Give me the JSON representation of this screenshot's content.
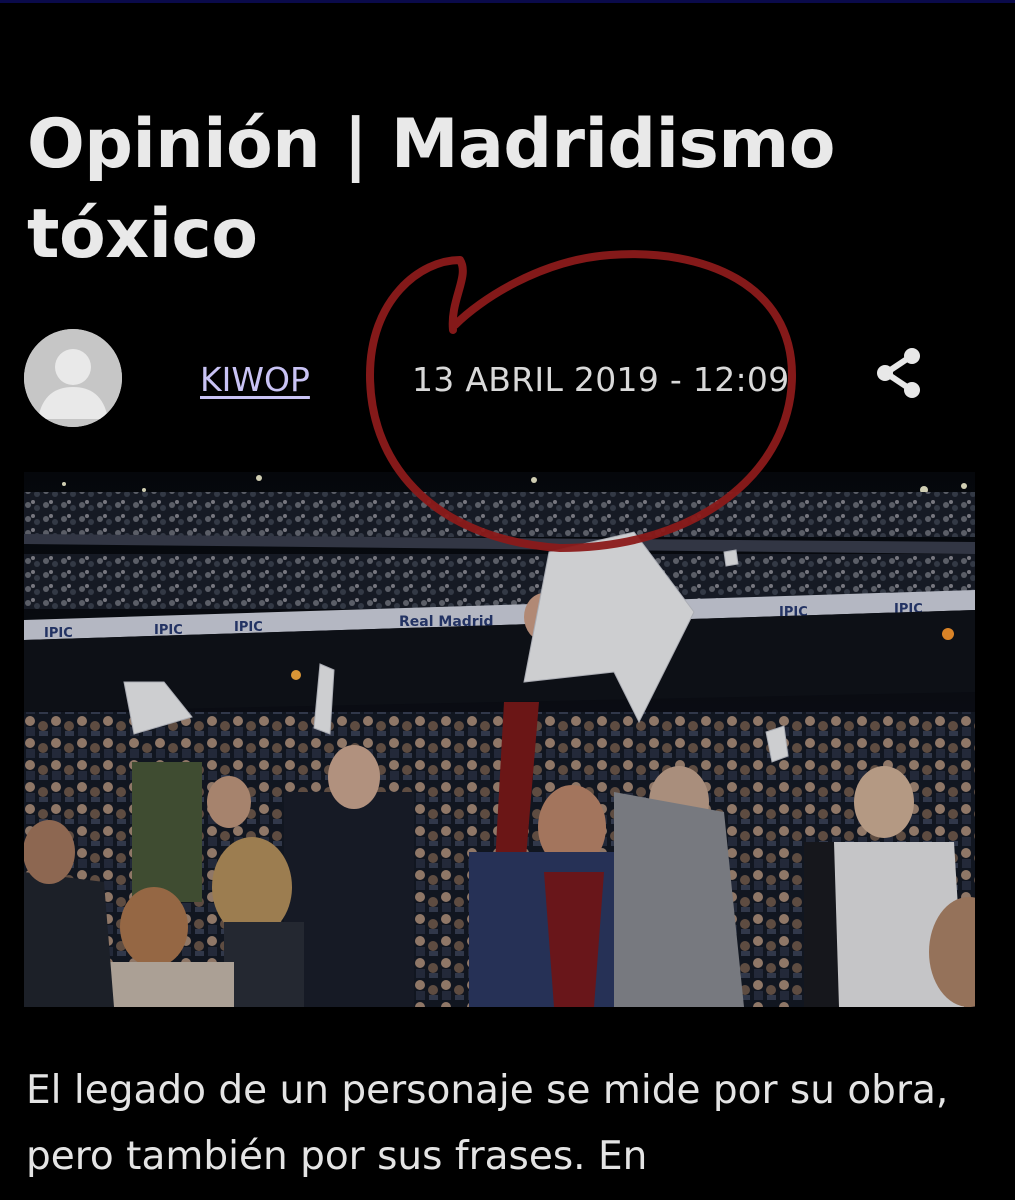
{
  "article": {
    "title": "Opinión | Madridismo tóxico",
    "author": "KIWOP",
    "datetime": "13 ABRIL 2019 - 12:09",
    "lead": "El legado de un personaje se mide por su obra, pero también por sus frases. En"
  },
  "icons": {
    "avatar": "user-placeholder-icon",
    "share": "share-icon"
  },
  "image": {
    "banner_texts": [
      "IPIC",
      "IPIC",
      "IPIC",
      "Real Madrid",
      "IPIC",
      "IPIC"
    ]
  },
  "colors": {
    "background": "#000000",
    "title": "#e9e9e9",
    "author_link": "#c9c3f5",
    "annotation_circle": "#8b1a1a"
  }
}
